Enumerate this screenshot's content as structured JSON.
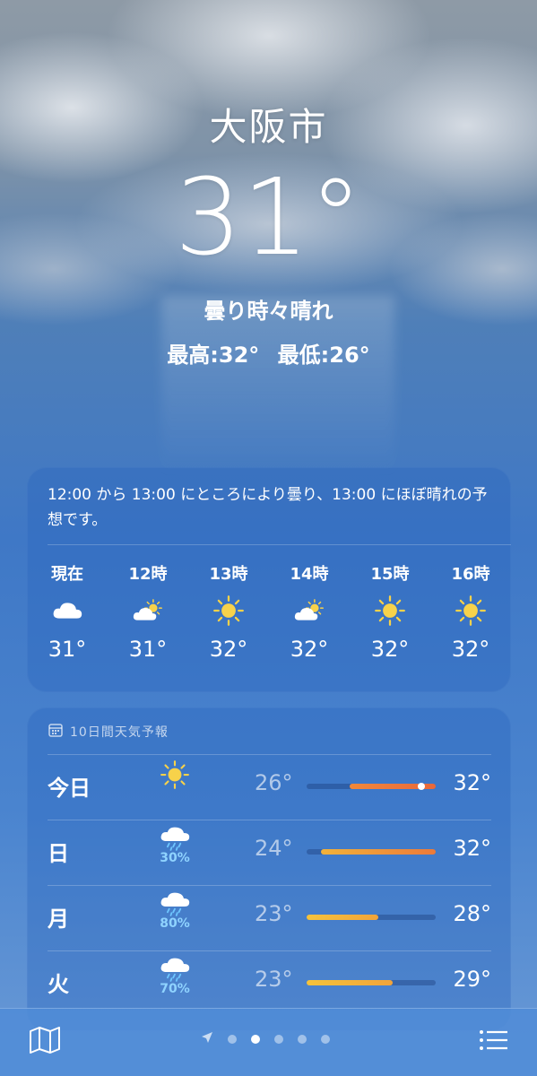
{
  "location": {
    "city": "大阪市",
    "temperature": "31°",
    "condition": "曇り時々晴れ",
    "high": "最高:32°",
    "low": "最低:26°"
  },
  "hourly": {
    "summary": "12:00 から 13:00 にところにより曇り、13:00 にほぼ晴れの予想です。",
    "items": [
      {
        "label": "現在",
        "icon": "cloud-icon",
        "temp": "31°"
      },
      {
        "label": "12時",
        "icon": "partly-sunny-icon",
        "temp": "31°"
      },
      {
        "label": "13時",
        "icon": "sun-icon",
        "temp": "32°"
      },
      {
        "label": "14時",
        "icon": "partly-sunny-icon",
        "temp": "32°"
      },
      {
        "label": "15時",
        "icon": "sun-icon",
        "temp": "32°"
      },
      {
        "label": "16時",
        "icon": "sun-icon",
        "temp": "32°"
      }
    ]
  },
  "daily": {
    "title": "10日間天気予報",
    "range": [
      23,
      32
    ],
    "days": [
      {
        "day": "今日",
        "icon": "sun-icon",
        "pop": "",
        "low": "26°",
        "high": "32°",
        "low_val": 26,
        "high_val": 32,
        "current_val": 31,
        "colors": [
          "#f0883a",
          "#e8683a"
        ]
      },
      {
        "day": "日",
        "icon": "rain-cloud-icon",
        "pop": "30%",
        "low": "24°",
        "high": "32°",
        "low_val": 24,
        "high_val": 32,
        "colors": [
          "#f2b23a",
          "#ec7a3a"
        ]
      },
      {
        "day": "月",
        "icon": "rain-cloud-icon",
        "pop": "80%",
        "low": "23°",
        "high": "28°",
        "low_val": 23,
        "high_val": 28,
        "colors": [
          "#f5c33c",
          "#f2a43a"
        ]
      },
      {
        "day": "火",
        "icon": "rain-cloud-icon",
        "pop": "70%",
        "low": "23°",
        "high": "29°",
        "low_val": 23,
        "high_val": 29,
        "colors": [
          "#f5c33c",
          "#f2a43a"
        ]
      }
    ]
  },
  "toolbar": {
    "map_icon": "map-icon",
    "list_icon": "list-icon",
    "location_icon": "location-arrow-icon",
    "page_count": 5,
    "active_page": 1
  }
}
